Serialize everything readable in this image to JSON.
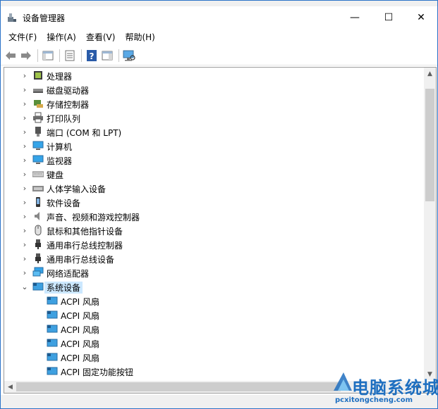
{
  "window": {
    "title": "设备管理器",
    "minimize": "—",
    "maximize": "☐",
    "close": "✕"
  },
  "menu": [
    "文件(F)",
    "操作(A)",
    "查看(V)",
    "帮助(H)"
  ],
  "toolbar": [
    "back",
    "forward",
    "properties-panel",
    "device-list",
    "help",
    "action-panel",
    "monitor"
  ],
  "tree": {
    "categories": [
      {
        "label": "处理器",
        "icon": "processor-icon"
      },
      {
        "label": "磁盘驱动器",
        "icon": "disk-drive-icon"
      },
      {
        "label": "存储控制器",
        "icon": "storage-controller-icon"
      },
      {
        "label": "打印队列",
        "icon": "printer-icon"
      },
      {
        "label": "端口 (COM 和 LPT)",
        "icon": "port-icon"
      },
      {
        "label": "计算机",
        "icon": "computer-icon"
      },
      {
        "label": "监视器",
        "icon": "monitor-icon"
      },
      {
        "label": "键盘",
        "icon": "keyboard-icon"
      },
      {
        "label": "人体学输入设备",
        "icon": "hid-icon"
      },
      {
        "label": "软件设备",
        "icon": "software-device-icon"
      },
      {
        "label": "声音、视频和游戏控制器",
        "icon": "sound-icon"
      },
      {
        "label": "鼠标和其他指针设备",
        "icon": "mouse-icon"
      },
      {
        "label": "通用串行总线控制器",
        "icon": "usb-icon"
      },
      {
        "label": "通用串行总线设备",
        "icon": "usb-icon"
      },
      {
        "label": "网络适配器",
        "icon": "network-adapter-icon"
      },
      {
        "label": "系统设备",
        "icon": "system-device-icon",
        "expanded": true
      }
    ],
    "children": [
      "ACPI 风扇",
      "ACPI 风扇",
      "ACPI 风扇",
      "ACPI 风扇",
      "ACPI 风扇",
      "ACPI 固定功能按钮"
    ]
  },
  "watermark": {
    "main": "电脑系统城",
    "sub": "pcxitongcheng.com"
  },
  "colors": {
    "selection": "#cce8ff",
    "accent": "#2b73c8"
  }
}
